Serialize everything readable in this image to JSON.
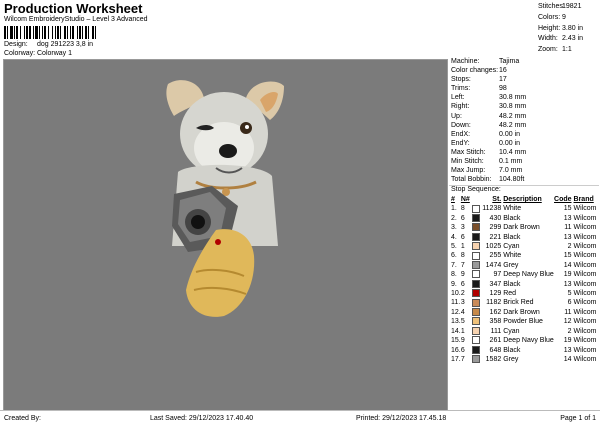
{
  "header": {
    "title": "Production Worksheet",
    "subtitle": "Wilcom EmbroideryStudio – Level 3 Advanced",
    "design_label": "Design:",
    "design_value": "dog 291223 3,8 in",
    "colorway_label": "Colorway:",
    "colorway_value": "Colorway 1"
  },
  "summary": [
    {
      "k": "Stitches:",
      "v": "19821"
    },
    {
      "k": "Colors:",
      "v": "9"
    },
    {
      "k": "Height:",
      "v": "3.80 in"
    },
    {
      "k": "Width:",
      "v": "2.43 in"
    },
    {
      "k": "Zoom:",
      "v": "1:1"
    }
  ],
  "machine_info": [
    {
      "k": "Machine:",
      "v": "Tajima"
    },
    {
      "k": "Color changes:",
      "v": "16"
    },
    {
      "k": "Stops:",
      "v": "17"
    },
    {
      "k": "Trims:",
      "v": "98"
    },
    {
      "k": "Left:",
      "v": "30.8 mm"
    },
    {
      "k": "Right:",
      "v": "30.8 mm"
    },
    {
      "k": "Up:",
      "v": "48.2 mm"
    },
    {
      "k": "Down:",
      "v": "48.2 mm"
    },
    {
      "k": "EndX:",
      "v": "0.00 in"
    },
    {
      "k": "EndY:",
      "v": "0.00 in"
    },
    {
      "k": "Max Stitch:",
      "v": "10.4 mm"
    },
    {
      "k": "Min Stitch:",
      "v": "0.1 mm"
    },
    {
      "k": "Max Jump:",
      "v": "7.0 mm"
    },
    {
      "k": "Total Bobbin:",
      "v": "104.80ft"
    }
  ],
  "stop_sequence": {
    "title": "Stop Sequence:",
    "headers": [
      "#",
      "N#",
      "",
      "St.",
      "Description",
      "Code",
      "Brand"
    ],
    "rows": [
      {
        "n": "1.",
        "needle": "8",
        "color": "#ffffff",
        "st": "11238",
        "desc": "White",
        "code": "15",
        "brand": "Wilcom"
      },
      {
        "n": "2.",
        "needle": "6",
        "color": "#1a1a1a",
        "st": "430",
        "desc": "Black",
        "code": "13",
        "brand": "Wilcom"
      },
      {
        "n": "3.",
        "needle": "3",
        "color": "#7a4f2a",
        "st": "299",
        "desc": "Dark Brown",
        "code": "11",
        "brand": "Wilcom"
      },
      {
        "n": "4.",
        "needle": "6",
        "color": "#1a1a1a",
        "st": "221",
        "desc": "Black",
        "code": "13",
        "brand": "Wilcom"
      },
      {
        "n": "5.",
        "needle": "1",
        "color": "#f7d3b0",
        "st": "1025",
        "desc": "Cyan",
        "code": "2",
        "brand": "Wilcom"
      },
      {
        "n": "6.",
        "needle": "8",
        "color": "#ffffff",
        "st": "255",
        "desc": "White",
        "code": "15",
        "brand": "Wilcom"
      },
      {
        "n": "7.",
        "needle": "7",
        "color": "#9a9a9a",
        "st": "1474",
        "desc": "Grey",
        "code": "14",
        "brand": "Wilcom"
      },
      {
        "n": "8.",
        "needle": "9",
        "color": "#ffffff",
        "st": "97",
        "desc": "Deep Navy Blue",
        "code": "19",
        "brand": "Wilcom"
      },
      {
        "n": "9.",
        "needle": "6",
        "color": "#1a1a1a",
        "st": "347",
        "desc": "Black",
        "code": "13",
        "brand": "Wilcom"
      },
      {
        "n": "10.",
        "needle": "2",
        "color": "#b00000",
        "st": "129",
        "desc": "Red",
        "code": "5",
        "brand": "Wilcom"
      },
      {
        "n": "11.",
        "needle": "3",
        "color": "#c98b5a",
        "st": "1182",
        "desc": "Brick Red",
        "code": "6",
        "brand": "Wilcom"
      },
      {
        "n": "12.",
        "needle": "4",
        "color": "#c78a4a",
        "st": "162",
        "desc": "Dark Brown",
        "code": "11",
        "brand": "Wilcom"
      },
      {
        "n": "13.",
        "needle": "5",
        "color": "#f0c27a",
        "st": "358",
        "desc": "Powder Blue",
        "code": "12",
        "brand": "Wilcom"
      },
      {
        "n": "14.",
        "needle": "1",
        "color": "#f7d3b0",
        "st": "111",
        "desc": "Cyan",
        "code": "2",
        "brand": "Wilcom"
      },
      {
        "n": "15.",
        "needle": "9",
        "color": "#ffffff",
        "st": "261",
        "desc": "Deep Navy Blue",
        "code": "19",
        "brand": "Wilcom"
      },
      {
        "n": "16.",
        "needle": "6",
        "color": "#1a1a1a",
        "st": "648",
        "desc": "Black",
        "code": "13",
        "brand": "Wilcom"
      },
      {
        "n": "17.",
        "needle": "7",
        "color": "#9a9a9a",
        "st": "1582",
        "desc": "Grey",
        "code": "14",
        "brand": "Wilcom"
      }
    ]
  },
  "footer": {
    "created_by": "Created By:",
    "last_saved": "Last Saved: 29/12/2023 17.40.40",
    "printed": "Printed: 29/12/2023 17.45.18",
    "page": "Page 1 of 1"
  },
  "colors": {
    "canvas_bg": "#7b7b7b"
  }
}
